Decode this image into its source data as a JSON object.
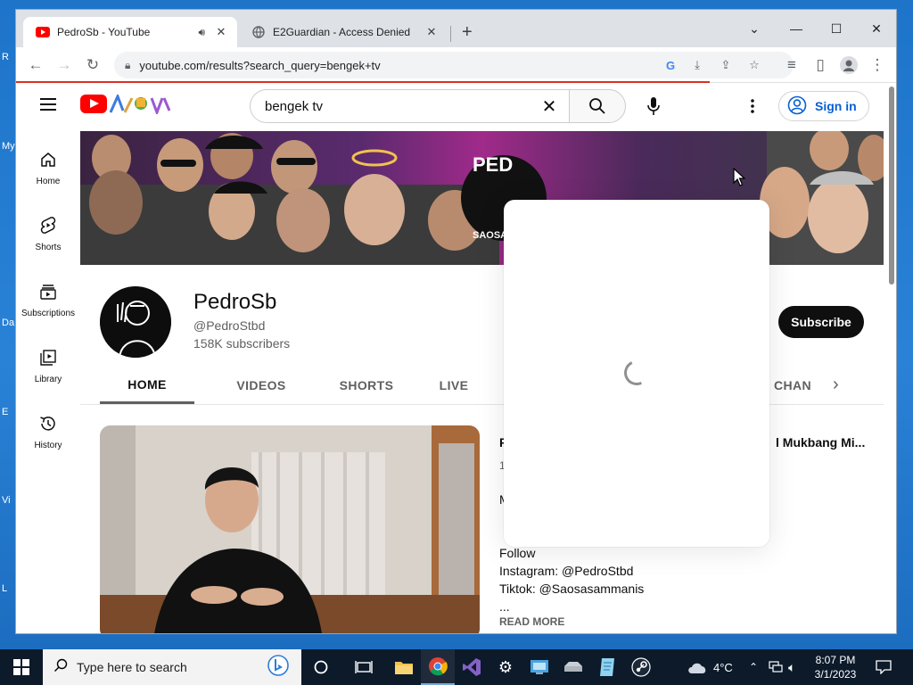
{
  "desktop": {
    "labels": [
      "R",
      "My",
      "Da",
      "E",
      "Vi",
      "L"
    ]
  },
  "browser": {
    "tabs": [
      {
        "title": "PedroSb - YouTube",
        "active": true
      },
      {
        "title": "E2Guardian - Access Denied",
        "active": false
      }
    ],
    "url": "youtube.com/results?search_query=bengek+tv"
  },
  "youtube": {
    "search_query": "bengek tv",
    "signin_label": "Sign in",
    "guide": [
      {
        "label": "Home",
        "icon": "home-icon"
      },
      {
        "label": "Shorts",
        "icon": "shorts-icon"
      },
      {
        "label": "Subscriptions",
        "icon": "subscriptions-icon"
      },
      {
        "label": "Library",
        "icon": "library-icon"
      },
      {
        "label": "History",
        "icon": "history-icon"
      }
    ],
    "channel": {
      "name": "PedroSb",
      "handle": "@PedroStbd",
      "subscribers": "158K subscribers",
      "subscribe_label": "Subscribe"
    },
    "tabs": [
      "HOME",
      "VIDEOS",
      "SHORTS",
      "LIVE",
      "CHAN"
    ],
    "featured": {
      "title_left": "F",
      "title_right": "l Mukbang Mi...",
      "meta_left": "1",
      "description": [
        "Mukbang Produk Mamee Ghostpepper!",
        "",
        "",
        "Follow",
        "Instagram: @PedroStbd",
        "Tiktok: @Saosasammanis",
        "..."
      ],
      "read_more": "READ MORE"
    },
    "banner_text": [
      "PED",
      "SAOSAS"
    ]
  },
  "taskbar": {
    "search_placeholder": "Type here to search",
    "weather": "4°C",
    "time": "8:07 PM",
    "date": "3/1/2023"
  }
}
